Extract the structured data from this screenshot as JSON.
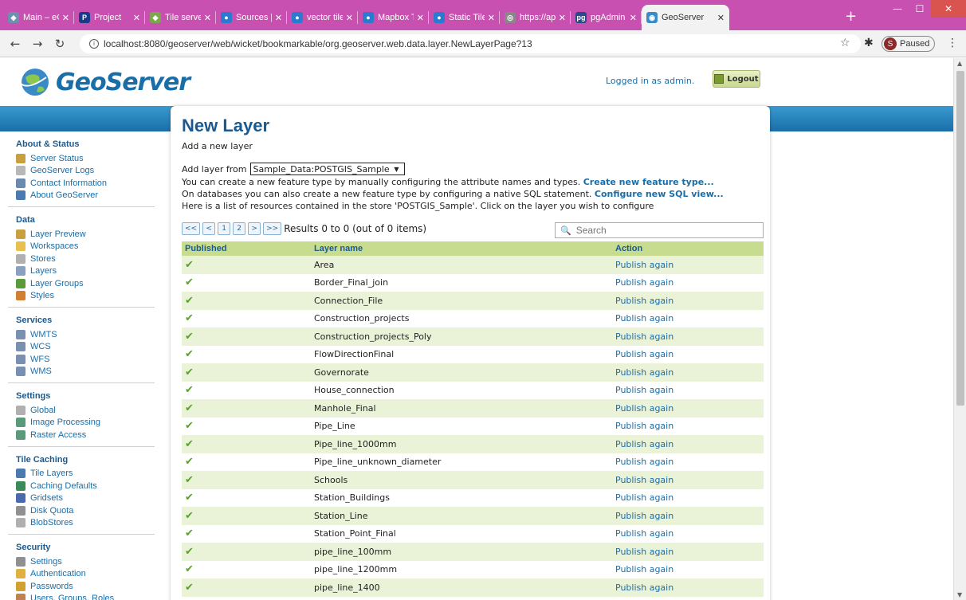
{
  "browser": {
    "tabs": [
      {
        "title": "Main – eC",
        "favicon": "eclipse-favicon",
        "color": "#6f8fb0",
        "glyph": "◈"
      },
      {
        "title": "Project",
        "favicon": "project-favicon",
        "color": "#1a3a8a",
        "glyph": "P"
      },
      {
        "title": "Tile server",
        "favicon": "tile-favicon",
        "color": "#7aa84a",
        "glyph": "◆"
      },
      {
        "title": "Sources |",
        "favicon": "mapbox-favicon",
        "color": "#2a7ad0",
        "glyph": "●"
      },
      {
        "title": "vector tile",
        "favicon": "mapbox-favicon",
        "color": "#2a7ad0",
        "glyph": "●"
      },
      {
        "title": "Mapbox T",
        "favicon": "mapbox-favicon",
        "color": "#2a7ad0",
        "glyph": "●"
      },
      {
        "title": "Static Tile",
        "favicon": "mapbox-favicon",
        "color": "#2a7ad0",
        "glyph": "●"
      },
      {
        "title": "https://ap",
        "favicon": "web-favicon",
        "color": "#888888",
        "glyph": "◎"
      },
      {
        "title": "pgAdmin",
        "favicon": "pgadmin-favicon",
        "color": "#2a4a8a",
        "glyph": "pg"
      }
    ],
    "active_tab": {
      "title": "GeoServer",
      "favicon": "geoserver-favicon"
    },
    "close_glyph": "✕",
    "new_tab": "+",
    "url": "localhost:8080/geoserver/web/wicket/bookmarkable/org.geoserver.web.data.layer.NewLayerPage?13",
    "profile_initial": "S",
    "profile_status": "Paused"
  },
  "header": {
    "logo_text": "GeoServer",
    "logged_in": "Logged in as admin.",
    "logout_label": "Logout"
  },
  "sidebar": [
    {
      "title": "About & Status",
      "items": [
        {
          "label": "Server Status",
          "icon": "server-status-icon",
          "color": "#c8a040"
        },
        {
          "label": "GeoServer Logs",
          "icon": "logs-icon",
          "color": "#b8b8b8"
        },
        {
          "label": "Contact Information",
          "icon": "contact-icon",
          "color": "#6a8ab0"
        },
        {
          "label": "About GeoServer",
          "icon": "about-icon",
          "color": "#4a7ab0"
        }
      ]
    },
    {
      "title": "Data",
      "items": [
        {
          "label": "Layer Preview",
          "icon": "layer-preview-icon",
          "color": "#c8a040"
        },
        {
          "label": "Workspaces",
          "icon": "workspaces-icon",
          "color": "#e8c050"
        },
        {
          "label": "Stores",
          "icon": "stores-icon",
          "color": "#b0b0b0"
        },
        {
          "label": "Layers",
          "icon": "layers-icon",
          "color": "#8aa0c0"
        },
        {
          "label": "Layer Groups",
          "icon": "layer-groups-icon",
          "color": "#5a9a3a"
        },
        {
          "label": "Styles",
          "icon": "styles-icon",
          "color": "#d08030"
        }
      ]
    },
    {
      "title": "Services",
      "items": [
        {
          "label": "WMTS",
          "icon": "wmts-icon",
          "color": "#7a90b0"
        },
        {
          "label": "WCS",
          "icon": "wcs-icon",
          "color": "#7a90b0"
        },
        {
          "label": "WFS",
          "icon": "wfs-icon",
          "color": "#7a90b0"
        },
        {
          "label": "WMS",
          "icon": "wms-icon",
          "color": "#7a90b0"
        }
      ]
    },
    {
      "title": "Settings",
      "items": [
        {
          "label": "Global",
          "icon": "global-icon",
          "color": "#b0b0b0"
        },
        {
          "label": "Image Processing",
          "icon": "image-processing-icon",
          "color": "#5a9a7a"
        },
        {
          "label": "Raster Access",
          "icon": "raster-access-icon",
          "color": "#5a9a7a"
        }
      ]
    },
    {
      "title": "Tile Caching",
      "items": [
        {
          "label": "Tile Layers",
          "icon": "tile-layers-icon",
          "color": "#4a7ab0"
        },
        {
          "label": "Caching Defaults",
          "icon": "caching-defaults-icon",
          "color": "#3a8a5a"
        },
        {
          "label": "Gridsets",
          "icon": "gridsets-icon",
          "color": "#4a6ab0"
        },
        {
          "label": "Disk Quota",
          "icon": "disk-quota-icon",
          "color": "#909090"
        },
        {
          "label": "BlobStores",
          "icon": "blobstores-icon",
          "color": "#b0b0b0"
        }
      ]
    },
    {
      "title": "Security",
      "items": [
        {
          "label": "Settings",
          "icon": "security-settings-icon",
          "color": "#909090"
        },
        {
          "label": "Authentication",
          "icon": "authentication-icon",
          "color": "#e0b040"
        },
        {
          "label": "Passwords",
          "icon": "passwords-icon",
          "color": "#d0a030"
        },
        {
          "label": "Users, Groups, Roles",
          "icon": "users-icon",
          "color": "#c08050"
        }
      ]
    }
  ],
  "main": {
    "title": "New Layer",
    "subtitle": "Add a new layer",
    "add_from_label": "Add layer from",
    "store_selected": "Sample_Data:POSTGIS_Sample",
    "line1_text": "You can create a new feature type by manually configuring the attribute names and types.",
    "line1_link": "Create new feature type...",
    "line2_text": "On databases you can also create a new feature type by configuring a native SQL statement.",
    "line2_link": "Configure new SQL view...",
    "line3_text": "Here is a list of resources contained in the store 'POSTGIS_Sample'. Click on the layer you wish to configure",
    "pager": [
      "<<",
      "<",
      "1",
      "2",
      ">",
      ">>"
    ],
    "results": "Results 0 to 0 (out of 0 items)",
    "search_placeholder": "Search",
    "columns": [
      "Published",
      "Layer name",
      "Action"
    ],
    "check_glyph": "✔",
    "rows": [
      {
        "name": "Area",
        "action": "Publish again"
      },
      {
        "name": "Border_Final_join",
        "action": "Publish again"
      },
      {
        "name": "Connection_File",
        "action": "Publish again"
      },
      {
        "name": "Construction_projects",
        "action": "Publish again"
      },
      {
        "name": "Construction_projects_Poly",
        "action": "Publish again"
      },
      {
        "name": "FlowDirectionFinal",
        "action": "Publish again"
      },
      {
        "name": "Governorate",
        "action": "Publish again"
      },
      {
        "name": "House_connection",
        "action": "Publish again"
      },
      {
        "name": "Manhole_Final",
        "action": "Publish again"
      },
      {
        "name": "Pipe_Line",
        "action": "Publish again"
      },
      {
        "name": "Pipe_line_1000mm",
        "action": "Publish again"
      },
      {
        "name": "Pipe_line_unknown_diameter",
        "action": "Publish again"
      },
      {
        "name": "Schools",
        "action": "Publish again"
      },
      {
        "name": "Station_Buildings",
        "action": "Publish again"
      },
      {
        "name": "Station_Line",
        "action": "Publish again"
      },
      {
        "name": "Station_Point_Final",
        "action": "Publish again"
      },
      {
        "name": "pipe_line_100mm",
        "action": "Publish again"
      },
      {
        "name": "pipe_line_1200mm",
        "action": "Publish again"
      },
      {
        "name": "pipe_line_1400",
        "action": "Publish again"
      }
    ]
  }
}
